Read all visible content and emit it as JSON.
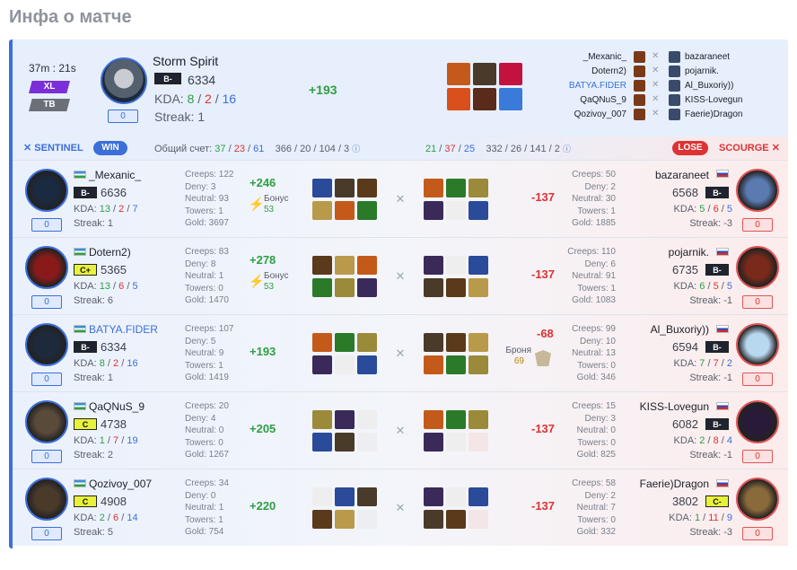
{
  "page_title": "Инфа о матче",
  "header": {
    "duration": "37m : 21s",
    "badge_xl": "XL",
    "badge_tb": "TB",
    "hero": "Storm Spirit",
    "rank": "B-",
    "mmr": "6334",
    "kda_label": "KDA:",
    "k": "8",
    "d": "2",
    "a": "16",
    "streak": "Streak: 1",
    "zero": "0",
    "gain": "+193",
    "matchups": [
      {
        "left": "_Mexanic_",
        "right": "bazaraneet"
      },
      {
        "left": "Dotern2)",
        "right": "pojarnik."
      },
      {
        "left": "BATYA.FIDER",
        "right": "Al_Buxoriy))"
      },
      {
        "left": "QaQNuS_9",
        "right": "KISS-Lovegun"
      },
      {
        "left": "Qozivoy_007",
        "right": "Faerie)Dragon"
      }
    ]
  },
  "scoreline": {
    "sentinel": "SENTINEL",
    "win": "WIN",
    "total_label": "Общий счет:",
    "k1": "37",
    "d1": "23",
    "a1": "61",
    "s1": "366 / 20 / 104 / 3",
    "k2": "21",
    "d2": "37",
    "a2": "25",
    "s2": "332 / 26 / 141 / 2",
    "lose": "LOSE",
    "scourge": "SCOURGE"
  },
  "rows": [
    {
      "l": {
        "name": "_Mexanic_",
        "rank": "B-",
        "mmr": "6636",
        "k": "13",
        "d": "2",
        "a": "7",
        "streak": "Streak: 1",
        "creeps": "Creeps: 122",
        "deny": "Deny: 3",
        "neutral": "Neutral: 93",
        "towers": "Towers: 1",
        "gold": "Gold: 3697",
        "gain": "+246",
        "bonus": "Бонус",
        "bonus_v": "53"
      },
      "r": {
        "name": "bazaraneet",
        "rank": "B-",
        "mmr": "6568",
        "k": "5",
        "d": "6",
        "a": "5",
        "streak": "Streak: -3",
        "creeps": "Creeps: 50",
        "deny": "Deny: 2",
        "neutral": "Neutral: 30",
        "towers": "Towers: 1",
        "gold": "Gold: 1885",
        "gain": "-137"
      }
    },
    {
      "l": {
        "name": "Dotern2)",
        "rank": "C+",
        "mmr": "5365",
        "k": "13",
        "d": "6",
        "a": "5",
        "streak": "Streak: 6",
        "creeps": "Creeps: 83",
        "deny": "Deny: 8",
        "neutral": "Neutral: 1",
        "towers": "Towers: 0",
        "gold": "Gold: 1470",
        "gain": "+278",
        "bonus": "Бонус",
        "bonus_v": "53"
      },
      "r": {
        "name": "pojarnik.",
        "rank": "B-",
        "mmr": "6735",
        "k": "6",
        "d": "5",
        "a": "5",
        "streak": "Streak: -1",
        "creeps": "Creeps: 110",
        "deny": "Deny: 6",
        "neutral": "Neutral: 91",
        "towers": "Towers: 1",
        "gold": "Gold: 1083",
        "gain": "-137"
      }
    },
    {
      "l": {
        "name": "BATYA.FIDER",
        "rank": "B-",
        "mmr": "6334",
        "k": "8",
        "d": "2",
        "a": "16",
        "streak": "Streak: 1",
        "creeps": "Creeps: 107",
        "deny": "Deny: 5",
        "neutral": "Neutral: 9",
        "towers": "Towers: 1",
        "gold": "Gold: 1419",
        "gain": "+193"
      },
      "r": {
        "name": "Al_Buxoriy))",
        "rank": "B-",
        "mmr": "6594",
        "k": "7",
        "d": "7",
        "a": "2",
        "streak": "Streak: -1",
        "creeps": "Creeps: 99",
        "deny": "Deny: 10",
        "neutral": "Neutral: 13",
        "towers": "Towers: 0",
        "gold": "Gold: 346",
        "gain": "-68",
        "armor": "Броня",
        "armor_v": "69"
      }
    },
    {
      "l": {
        "name": "QaQNuS_9",
        "rank": "C",
        "mmr": "4738",
        "k": "1",
        "d": "7",
        "a": "19",
        "streak": "Streak: 2",
        "creeps": "Creeps: 20",
        "deny": "Deny: 4",
        "neutral": "Neutral: 0",
        "towers": "Towers: 0",
        "gold": "Gold: 1267",
        "gain": "+205"
      },
      "r": {
        "name": "KISS-Lovegun",
        "rank": "B-",
        "mmr": "6082",
        "k": "2",
        "d": "8",
        "a": "4",
        "streak": "Streak: -1",
        "creeps": "Creeps: 15",
        "deny": "Deny: 3",
        "neutral": "Neutral: 0",
        "towers": "Towers: 0",
        "gold": "Gold: 825",
        "gain": "-137"
      }
    },
    {
      "l": {
        "name": "Qozivoy_007",
        "rank": "C",
        "mmr": "4908",
        "k": "2",
        "d": "6",
        "a": "14",
        "streak": "Streak: 5",
        "creeps": "Creeps: 34",
        "deny": "Deny: 0",
        "neutral": "Neutral: 1",
        "towers": "Towers: 1",
        "gold": "Gold: 754",
        "gain": "+220"
      },
      "r": {
        "name": "Faerie)Dragon",
        "rank": "C-",
        "mmr": "3802",
        "k": "1",
        "d": "11",
        "a": "9",
        "streak": "Streak: -3",
        "creeps": "Creeps: 58",
        "deny": "Deny: 2",
        "neutral": "Neutral: 7",
        "towers": "Towers: 0",
        "gold": "Gold: 332",
        "gain": "-137"
      }
    }
  ],
  "zero": "0"
}
